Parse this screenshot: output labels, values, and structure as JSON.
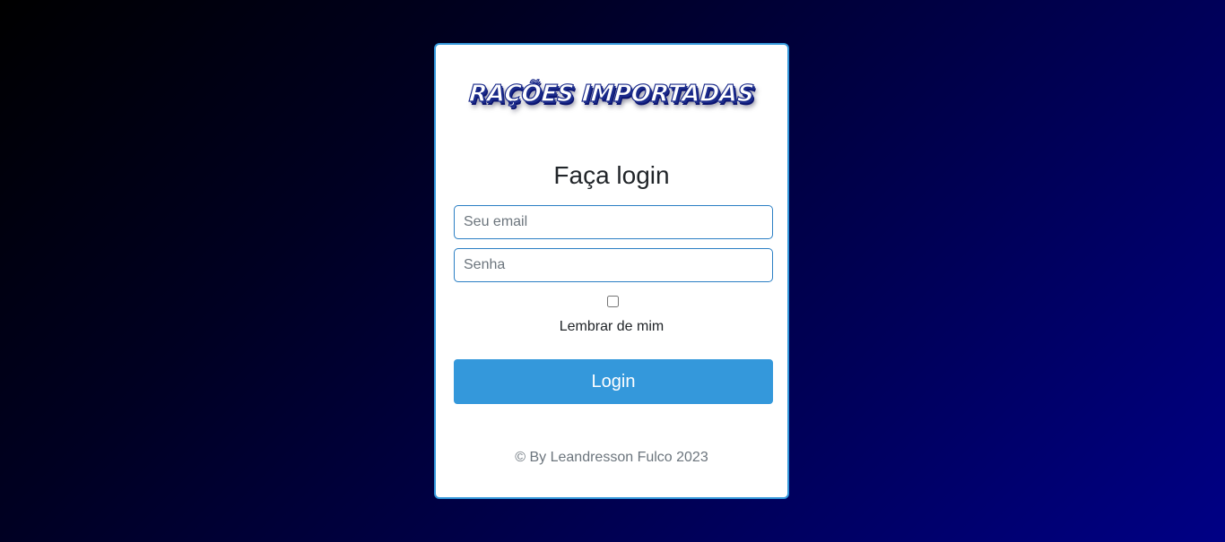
{
  "logo": {
    "text": "RAÇÕES IMPORTADAS"
  },
  "form": {
    "title": "Faça login",
    "email_placeholder": "Seu email",
    "email_value": "",
    "password_placeholder": "Senha",
    "password_value": "",
    "remember_label": "Lembrar de mim",
    "remember_checked": false,
    "submit_label": "Login"
  },
  "footer": {
    "text": "© By Leandresson Fulco 2023"
  },
  "colors": {
    "accent": "#3498db",
    "card_border": "#3498db",
    "background_dark": "#000000",
    "background_blue": "#000085"
  }
}
